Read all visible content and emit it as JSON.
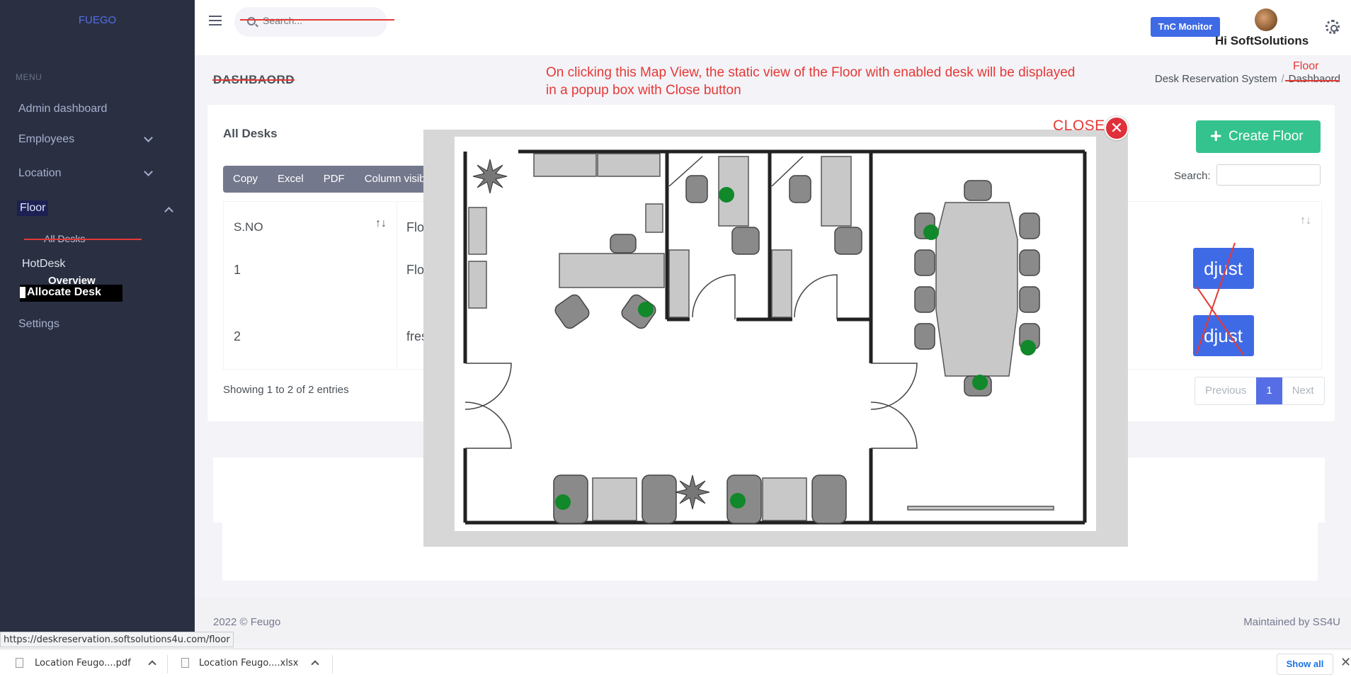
{
  "sidebar": {
    "brand": "FUEGO",
    "menu_title": "MENU",
    "items": [
      {
        "label": "Admin dashboard"
      },
      {
        "label": "Employees"
      },
      {
        "label": "Location"
      },
      {
        "label": "Floor"
      }
    ],
    "sub_item": "All Desks",
    "hotdesk": "HotDesk",
    "overview": "Overview",
    "allocate": "Allocate Desk",
    "settings": "Settings"
  },
  "topbar": {
    "search_placeholder": "Search...",
    "tnc_button": "TnC Monitor",
    "greeting": "Hi SoftSolutions"
  },
  "page": {
    "title": "DASHBAORD",
    "breadcrumb": [
      "Desk Reservation System",
      "Dashbaord"
    ],
    "annotation_line1": "On clicking this Map View, the static view of the Floor  with enabled desk will be displayed",
    "annotation_line2": "in a popup box with Close button",
    "annotation_floor": "Floor"
  },
  "card": {
    "title": "All Desks",
    "export_buttons": [
      "Copy",
      "Excel",
      "PDF",
      "Column visib"
    ],
    "create_button": "Create Floor",
    "search_label": "Search:",
    "table": {
      "header_sno": "S.NO",
      "header_floor": "Flo",
      "rows": [
        {
          "sno": "1",
          "floor": "Flo",
          "action": "djust"
        },
        {
          "sno": "2",
          "floor": "fres",
          "action": "djust"
        }
      ]
    },
    "showing": "Showing 1 to 2 of 2 entries",
    "pager": [
      "Previous",
      "1",
      "Next"
    ]
  },
  "modal": {
    "close_label": "CLOSE",
    "close_symbol": "✕"
  },
  "footer": {
    "left": "2022 © Feugo",
    "right": "Maintained by SS4U"
  },
  "status_url": "https://deskreservation.softsolutions4u.com/floor",
  "downloads": {
    "items": [
      {
        "name": "Location    Feugo....pdf"
      },
      {
        "name": "Location    Feugo....xlsx"
      }
    ],
    "show_all": "Show all"
  },
  "colors": {
    "sidebar": "#2a3042",
    "primary": "#556ee6",
    "success": "#34c38f",
    "annotation": "#e53935",
    "desk_marker": "#11882a"
  }
}
